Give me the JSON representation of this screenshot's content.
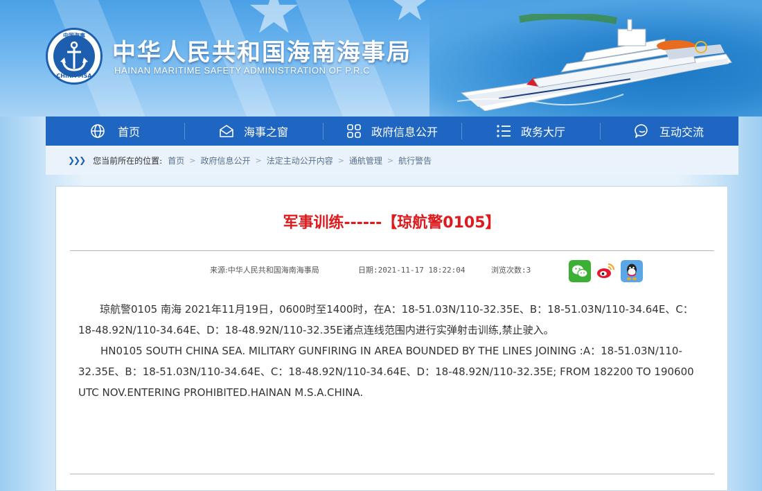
{
  "site": {
    "title": "中华人民共和国海南海事局",
    "subtitle": "HAINAN MARITIME SAFETY ADMINISTRATION OF P.R.C",
    "logo_text_top": "中国海事",
    "logo_text_bottom": "CHINA MSA"
  },
  "nav": {
    "items": [
      {
        "label": "首页",
        "icon": "globe-icon"
      },
      {
        "label": "海事之窗",
        "icon": "envelope-icon"
      },
      {
        "label": "政府信息公开",
        "icon": "grid-icon"
      },
      {
        "label": "政务大厅",
        "icon": "list-icon"
      },
      {
        "label": "互动交流",
        "icon": "chat-icon"
      }
    ]
  },
  "breadcrumb": {
    "prefix": "您当前所在的位置:",
    "items": [
      "首页",
      "政府信息公开",
      "法定主动公开内容",
      "通航管理",
      "航行警告"
    ]
  },
  "article": {
    "title": "军事训练------【琼航警0105】",
    "source": "来源:中华人民共和国海南海事局",
    "date": "日期:2021-11-17 18:22:04",
    "views": "浏览次数:3",
    "body_zh": "琼航警0105  南海 2021年11月19日，0600时至1400时，在A：18-51.03N/110-32.35E、B：18-51.03N/110-34.64E、C：18-48.92N/110-34.64E、D：18-48.92N/110-32.35E诸点连线范围内进行实弹射击训练,禁止驶入。",
    "body_en": "HN0105   SOUTH CHINA SEA. MILITARY GUNFIRING IN AREA BOUNDED BY THE LINES JOINING :A：18-51.03N/110-32.35E、B：18-51.03N/110-34.64E、C：18-48.92N/110-34.64E、D：18-48.92N/110-32.35E; FROM  182200  TO  190600 UTC NOV.ENTERING PROHIBITED.HAINAN M.S.A.CHINA."
  },
  "share": [
    {
      "name": "wechat-share-icon",
      "color": "#3cb034"
    },
    {
      "name": "weibo-share-icon",
      "color": "#ffffff"
    },
    {
      "name": "qq-share-icon",
      "color": "#5aa6e6"
    }
  ],
  "colors": {
    "nav_bg": "#1f66c2",
    "title_red": "#e0191d",
    "crumb_bg": "#eaf3fc"
  }
}
